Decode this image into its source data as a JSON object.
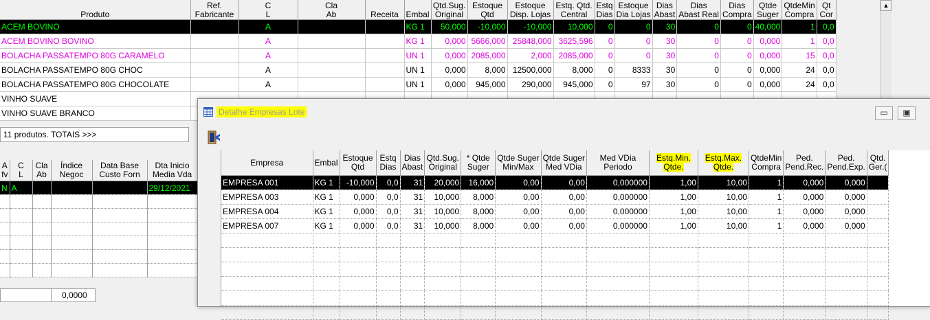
{
  "main_grid": {
    "headers": [
      "Produto",
      "Ref.\nFabricante",
      "C\nL",
      "Cla\nAb",
      "Receita",
      "Embal",
      "Qtd.Sug.\nOriginal",
      "Estoque\nQtd",
      "Estoque\nDisp. Lojas",
      "Estq. Qtd.\nCentral",
      "Estq\nDias",
      "Estoque\nDia Lojas",
      "Dias\nAbast",
      "Dias\nAbast Real",
      "Dias\nCompra",
      "Qtde\nSuger",
      "QtdeMin\nCompra",
      "Qt\nCor"
    ],
    "rows": [
      {
        "style": "sel",
        "cells": [
          "ACEM BOVINO",
          "",
          "A",
          "",
          "",
          "KG 1",
          "50,000",
          "-10,000",
          "-10,000",
          "10,000",
          "0",
          "0",
          "30",
          "0",
          "0",
          "40,000",
          "1",
          "0,0"
        ]
      },
      {
        "style": "mag",
        "cells": [
          "ACEM BOVINO BOVINO",
          "",
          "A",
          "",
          "",
          "KG 1",
          "0,000",
          "5666,000",
          "25848,000",
          "3625,596",
          "0",
          "0",
          "30",
          "0",
          "0",
          "0,000",
          "1",
          "0,0"
        ]
      },
      {
        "style": "mag",
        "cells": [
          "BOLACHA PASSATEMPO 80G CARAMELO",
          "",
          "A",
          "",
          "",
          "UN 1",
          "0,000",
          "2085,000",
          "2,000",
          "2085,000",
          "0",
          "0",
          "30",
          "0",
          "0",
          "0,000",
          "15",
          "0,0"
        ]
      },
      {
        "style": "",
        "cells": [
          "BOLACHA PASSATEMPO 80G CHOC",
          "",
          "A",
          "",
          "",
          "UN 1",
          "0,000",
          "8,000",
          "12500,000",
          "8,000",
          "0",
          "8333",
          "30",
          "0",
          "0",
          "0,000",
          "24",
          "0,0"
        ]
      },
      {
        "style": "",
        "cells": [
          "BOLACHA PASSATEMPO 80G CHOCOLATE",
          "",
          "A",
          "",
          "",
          "UN 1",
          "0,000",
          "945,000",
          "290,000",
          "945,000",
          "0",
          "97",
          "30",
          "0",
          "0",
          "0,000",
          "24",
          "0,0"
        ]
      },
      {
        "style": "",
        "cells": [
          "VINHO SUAVE",
          "",
          "",
          "",
          "",
          "",
          "",
          "",
          "",
          "",
          "",
          "",
          "",
          "",
          "",
          "",
          "",
          ""
        ]
      },
      {
        "style": "",
        "cells": [
          "VINHO SUAVE BRANCO",
          "",
          "",
          "",
          "",
          "",
          "",
          "",
          "",
          "",
          "",
          "",
          "",
          "",
          "",
          "",
          "",
          ""
        ]
      }
    ],
    "totals_label": "11 produtos. TOTAIS >>>"
  },
  "lower_grid": {
    "headers": [
      "A\nfv",
      "C\nL",
      "Cla\nAb",
      "Índice\nNegoc",
      "Data Base\nCusto Forn",
      "Dta Inicio\nMedia Vda"
    ],
    "rows": [
      [
        "N",
        "A",
        "",
        "",
        "",
        "29/12/2021"
      ],
      [
        "",
        "",
        "",
        "",
        "",
        ""
      ],
      [
        "",
        "",
        "",
        "",
        "",
        ""
      ],
      [
        "",
        "",
        "",
        "",
        "",
        ""
      ],
      [
        "",
        "",
        "",
        "",
        "",
        ""
      ],
      [
        "",
        "",
        "",
        "",
        "",
        ""
      ],
      [
        "",
        "",
        "",
        "",
        "",
        ""
      ]
    ],
    "footer_value": "0,0000"
  },
  "dialog": {
    "title": "Detalhe Empresas Lote",
    "headers": [
      "Empresa",
      "Embal",
      "Estoque\nQtd",
      "Estq\nDias",
      "Dias\nAbast",
      "Qtd.Sug.\nOriginal",
      "* Qtde\nSuger",
      "Qtde Suger\nMin/Max",
      "Qtde Suger\nMed VDia",
      "Med VDia\nPeriodo",
      "Estq.Min.\nQtde.",
      "Estq.Max.\nQtde.",
      "QtdeMin\nCompra",
      "Ped.\nPend.Rec.",
      "Ped.\nPend.Exp.",
      "Qtd.\nGer.("
    ],
    "highlighted_headers": [
      "Estq.Min.\nQtde.",
      "Estq.Max.\nQtde."
    ],
    "rows": [
      [
        "EMPRESA 001",
        "KG 1",
        "-10,000",
        "0,0",
        "31",
        "20,000",
        "16,000",
        "0,00",
        "0,00",
        "0,000000",
        "1,00",
        "10,00",
        "1",
        "0,000",
        "0,000",
        ""
      ],
      [
        "EMPRESA 003",
        "KG 1",
        "0,000",
        "0,0",
        "31",
        "10,000",
        "8,000",
        "0,00",
        "0,00",
        "0,000000",
        "1,00",
        "10,00",
        "1",
        "0,000",
        "0,000",
        ""
      ],
      [
        "EMPRESA 004",
        "KG 1",
        "0,000",
        "0,0",
        "31",
        "10,000",
        "8,000",
        "0,00",
        "0,00",
        "0,000000",
        "1,00",
        "10,00",
        "1",
        "0,000",
        "0,000",
        ""
      ],
      [
        "EMPRESA 007",
        "KG 1",
        "0,000",
        "0,0",
        "31",
        "10,000",
        "8,000",
        "0,00",
        "0,00",
        "0,000000",
        "1,00",
        "10,00",
        "1",
        "0,000",
        "0,000",
        ""
      ]
    ],
    "empty_rows": 6
  },
  "icons": {
    "exit": "exit-door-icon",
    "app": "grid-table-icon",
    "minimize": "minimize-icon",
    "maximize": "maximize-icon",
    "scroll_up": "scroll-up-arrow-icon"
  },
  "colors": {
    "selected_bg": "#000000",
    "selected_text_main": "#00ff00",
    "magenta_text": "#e000e0",
    "highlight": "#ffff00"
  }
}
